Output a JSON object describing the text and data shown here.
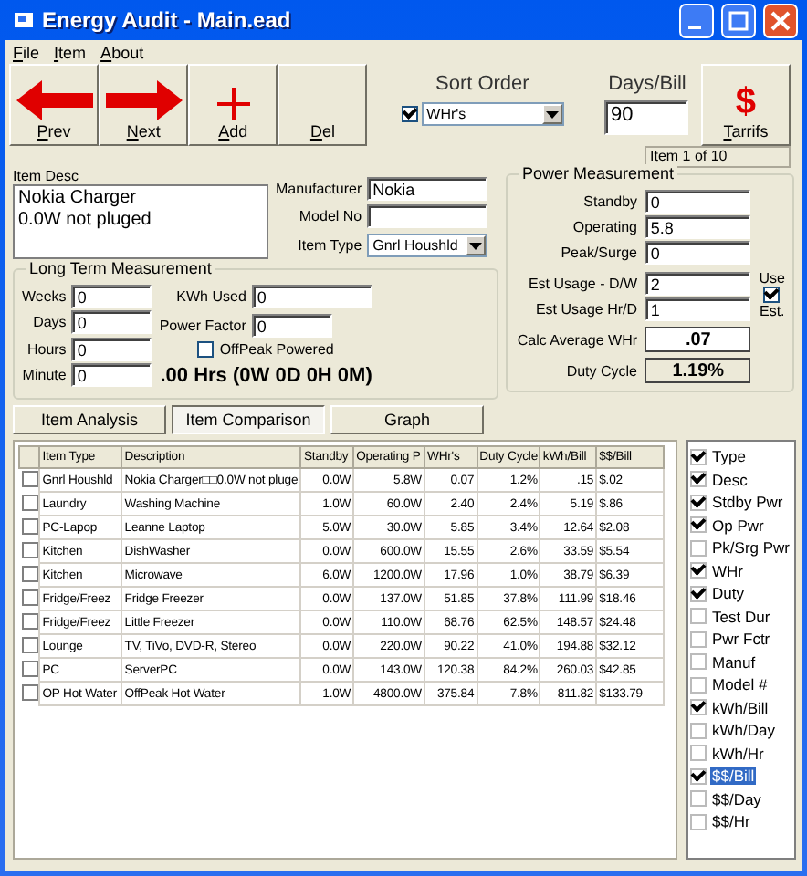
{
  "window": {
    "title": "Energy Audit - Main.ead"
  },
  "menu": [
    "File",
    "Item",
    "About"
  ],
  "toolbar": [
    {
      "label": "Prev",
      "kind": "prev"
    },
    {
      "label": "Next",
      "kind": "next"
    },
    {
      "label": "Add",
      "kind": "add"
    },
    {
      "label": "Del",
      "kind": "del"
    }
  ],
  "sort_order": {
    "label": "Sort Order",
    "checked": true,
    "value": "WHr's"
  },
  "days_bill": {
    "label": "Days/Bill",
    "value": "90"
  },
  "tarrifs_button": {
    "symbol": "$",
    "label": "Tarrifs"
  },
  "status": "Item 1 of 10",
  "item_desc": {
    "label": "Item Desc",
    "lines": [
      "Nokia Charger",
      "0.0W not pluged"
    ]
  },
  "item_fields": [
    {
      "label": "Manufacturer",
      "value": "Nokia",
      "kind": "text"
    },
    {
      "label": "Model No",
      "kind": "text"
    },
    {
      "label": "Item Type",
      "value": "Gnrl Houshld",
      "kind": "select"
    }
  ],
  "long_term": {
    "title": "Long Term Measurement",
    "fields": [
      {
        "label": "Weeks",
        "value": "0"
      },
      {
        "label": "Days",
        "value": "0"
      },
      {
        "label": "Hours",
        "value": "0"
      },
      {
        "label": "Minute",
        "value": "0"
      }
    ],
    "kwh_used": {
      "label": "KWh Used",
      "value": "0"
    },
    "power_factor": {
      "label": "Power Factor",
      "value": "0"
    },
    "offpeak": {
      "label": "OffPeak Powered",
      "checked": false
    },
    "summary": ".00 Hrs (0W 0D 0H 0M)"
  },
  "power": {
    "title": "Power Measurement",
    "fields": [
      {
        "label": "Standby",
        "value": "0"
      },
      {
        "label": "Operating",
        "value": "5.8"
      },
      {
        "label": "Peak/Surge",
        "value": "0"
      }
    ],
    "usage": [
      {
        "label": "Est Usage - D/W",
        "value": "2"
      },
      {
        "label": "Est Usage Hr/D",
        "value": "1"
      }
    ],
    "use_est": {
      "label_top": "Use",
      "checked": true,
      "label_bottom": "Est."
    },
    "results": [
      {
        "label": "Calc Average WHr",
        "value": ".07"
      },
      {
        "label": "Duty Cycle",
        "value": "1.19%"
      }
    ]
  },
  "tabs": [
    {
      "label": "Item Analysis",
      "selected": false
    },
    {
      "label": "Item Comparison",
      "selected": true
    },
    {
      "label": "Graph",
      "selected": false
    }
  ],
  "table": {
    "columns": [
      "Item Type",
      "Description",
      "Standby",
      "Operating P",
      "WHr's",
      "Duty Cycle",
      "kWh/Bill",
      "$$/Bill"
    ],
    "rows": [
      {
        "checked": false,
        "cells": [
          "Gnrl Houshld",
          "Nokia Charger□□0.0W not pluge",
          "0.0W",
          "5.8W",
          "0.07",
          "1.2%",
          ".15",
          "$.02"
        ]
      },
      {
        "checked": false,
        "cells": [
          "Laundry",
          "Washing Machine",
          "1.0W",
          "60.0W",
          "2.40",
          "2.4%",
          "5.19",
          "$.86"
        ]
      },
      {
        "checked": false,
        "cells": [
          "PC-Lapop",
          "Leanne Laptop",
          "5.0W",
          "30.0W",
          "5.85",
          "3.4%",
          "12.64",
          "$2.08"
        ]
      },
      {
        "checked": false,
        "cells": [
          "Kitchen",
          "DishWasher",
          "0.0W",
          "600.0W",
          "15.55",
          "2.6%",
          "33.59",
          "$5.54"
        ]
      },
      {
        "checked": false,
        "cells": [
          "Kitchen",
          "Microwave",
          "6.0W",
          "1200.0W",
          "17.96",
          "1.0%",
          "38.79",
          "$6.39"
        ]
      },
      {
        "checked": false,
        "cells": [
          "Fridge/Freez",
          "Fridge Freezer",
          "0.0W",
          "137.0W",
          "51.85",
          "37.8%",
          "111.99",
          "$18.46"
        ]
      },
      {
        "checked": false,
        "cells": [
          "Fridge/Freez",
          "Little Freezer",
          "0.0W",
          "110.0W",
          "68.76",
          "62.5%",
          "148.57",
          "$24.48"
        ]
      },
      {
        "checked": false,
        "cells": [
          "Lounge",
          "TV, TiVo, DVD-R, Stereo",
          "0.0W",
          "220.0W",
          "90.22",
          "41.0%",
          "194.88",
          "$32.12"
        ]
      },
      {
        "checked": false,
        "cells": [
          "PC",
          "ServerPC",
          "0.0W",
          "143.0W",
          "120.38",
          "84.2%",
          "260.03",
          "$42.85"
        ]
      },
      {
        "checked": false,
        "cells": [
          "OP Hot Water",
          "OffPeak Hot Water",
          "1.0W",
          "4800.0W",
          "375.84",
          "7.8%",
          "811.82",
          "$133.79"
        ]
      }
    ]
  },
  "column_list": [
    {
      "label": "Type",
      "checked": true,
      "selected": false
    },
    {
      "label": "Desc",
      "checked": true,
      "selected": false
    },
    {
      "label": "Stdby Pwr",
      "checked": true,
      "selected": false
    },
    {
      "label": "Op Pwr",
      "checked": true,
      "selected": false
    },
    {
      "label": "Pk/Srg Pwr",
      "checked": false,
      "selected": false
    },
    {
      "label": "WHr",
      "checked": true,
      "selected": false
    },
    {
      "label": "Duty",
      "checked": true,
      "selected": false
    },
    {
      "label": "Test Dur",
      "checked": false,
      "selected": false
    },
    {
      "label": "Pwr Fctr",
      "checked": false,
      "selected": false
    },
    {
      "label": "Manuf",
      "checked": false,
      "selected": false
    },
    {
      "label": "Model #",
      "checked": false,
      "selected": false
    },
    {
      "label": "kWh/Bill",
      "checked": true,
      "selected": false
    },
    {
      "label": "kWh/Day",
      "checked": false,
      "selected": false
    },
    {
      "label": "kWh/Hr",
      "checked": false,
      "selected": false
    },
    {
      "label": "$$/Bill",
      "checked": true,
      "selected": true
    },
    {
      "label": "$$/Day",
      "checked": false,
      "selected": false
    },
    {
      "label": "$$/Hr",
      "checked": false,
      "selected": false
    }
  ]
}
